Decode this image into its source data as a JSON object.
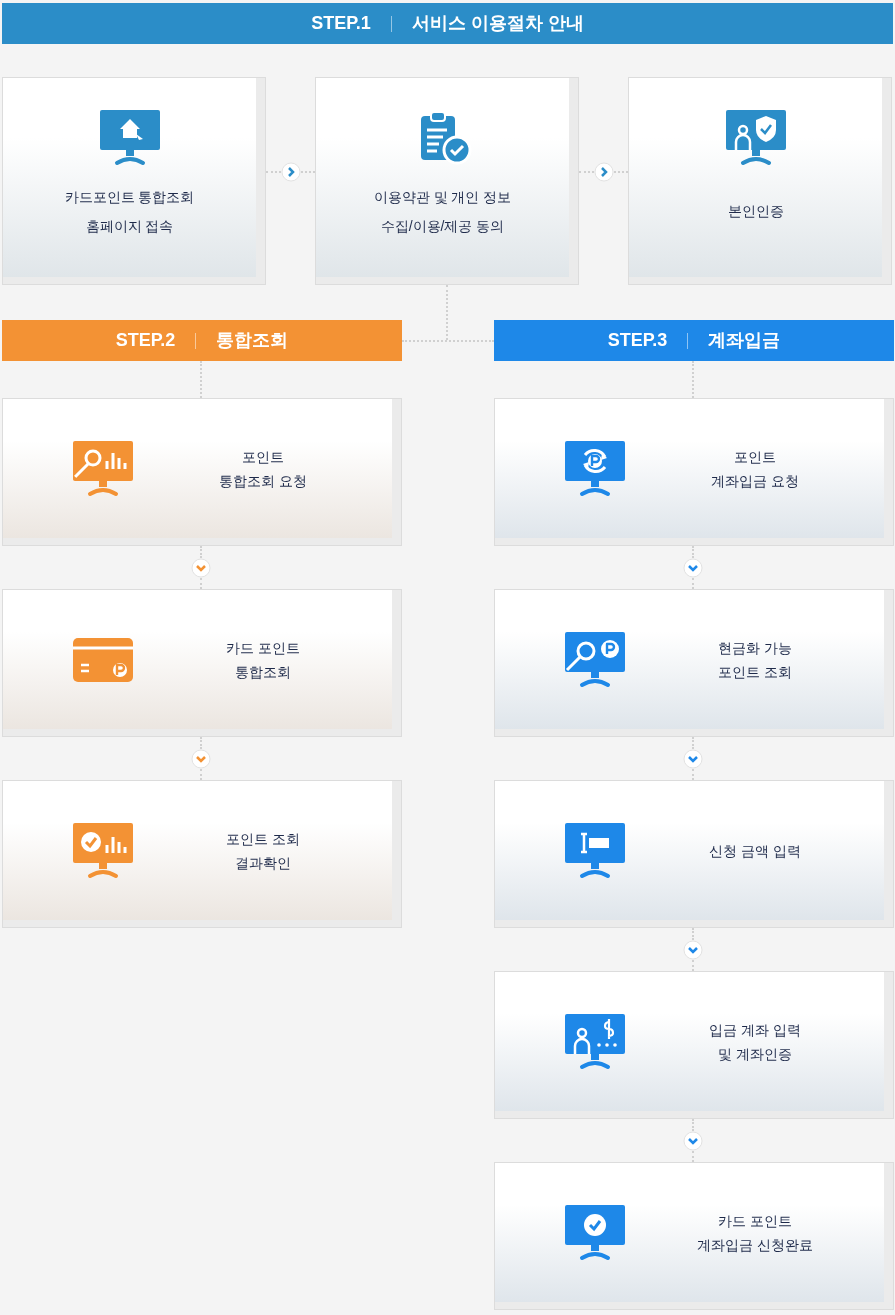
{
  "steps": [
    {
      "label": "STEP.1",
      "title": "서비스 이용절차 안내",
      "color": "#2b8dc8",
      "cards": [
        {
          "lines": [
            "카드포인트 통합조회",
            "홈페이지 접속"
          ]
        },
        {
          "lines": [
            "이용약관 및 개인 정보",
            "수집/이용/제공 동의"
          ]
        },
        {
          "lines": [
            "본인인증"
          ]
        }
      ]
    },
    {
      "label": "STEP.2",
      "title": "통합조회",
      "color": "#f39234",
      "cards": [
        {
          "lines": [
            "포인트",
            "통합조회 요청"
          ]
        },
        {
          "lines": [
            "카드 포인트",
            "통합조회"
          ]
        },
        {
          "lines": [
            "포인트 조회",
            "결과확인"
          ]
        }
      ]
    },
    {
      "label": "STEP.3",
      "title": "계좌입금",
      "color": "#1e88e8",
      "cards": [
        {
          "lines": [
            "포인트",
            "계좌입금 요청"
          ]
        },
        {
          "lines": [
            "현금화 가능",
            "포인트 조회"
          ]
        },
        {
          "lines": [
            "신청 금액 입력"
          ]
        },
        {
          "lines": [
            "입금 계좌 입력",
            "및 계좌인증"
          ]
        },
        {
          "lines": [
            "카드 포인트",
            "계좌입금 신청완료"
          ]
        }
      ]
    }
  ]
}
